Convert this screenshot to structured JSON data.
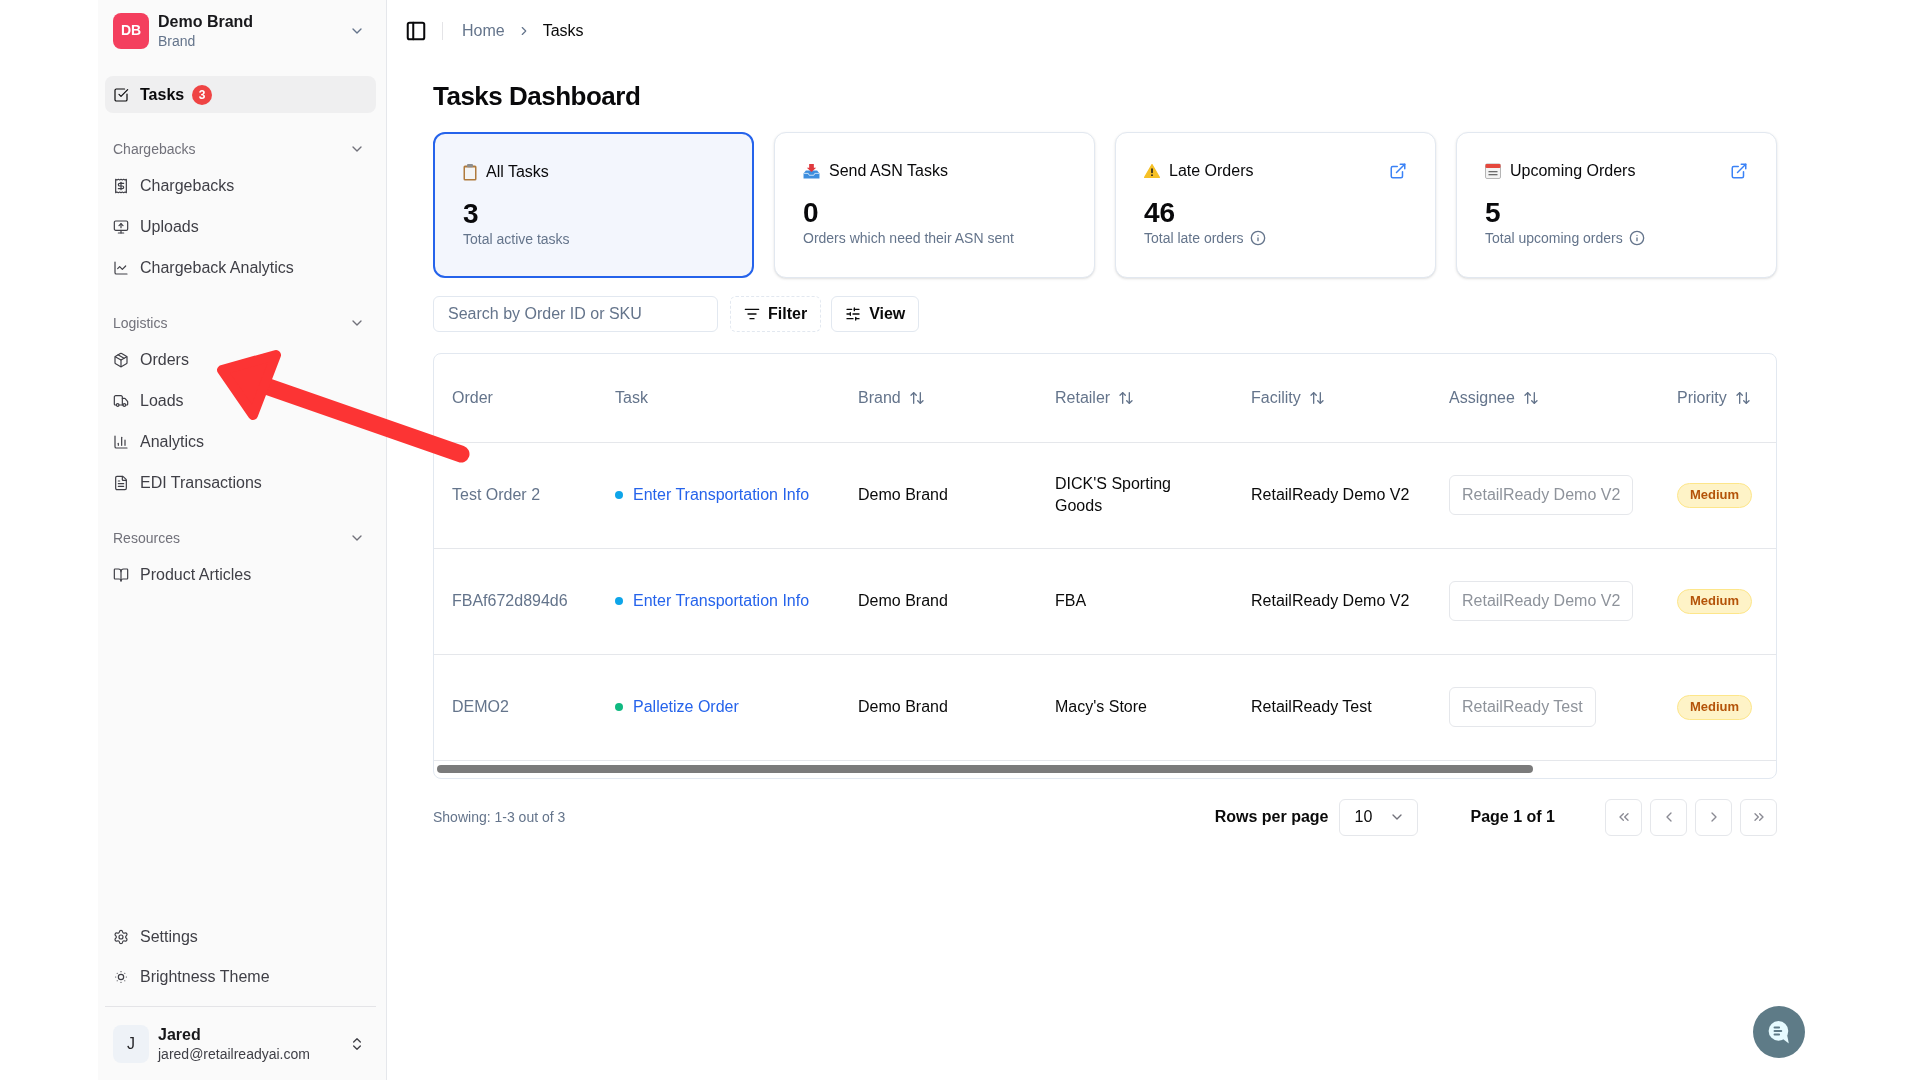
{
  "sidebar": {
    "workspace": {
      "initials": "DB",
      "name": "Demo Brand",
      "subtitle": "Brand"
    },
    "main_item": {
      "label": "Tasks",
      "badge": "3",
      "selected": true
    },
    "sections": [
      {
        "title": "Chargebacks",
        "expanded": true,
        "items": [
          {
            "label": "Chargebacks",
            "selected": false
          },
          {
            "label": "Uploads",
            "selected": false
          },
          {
            "label": "Chargeback Analytics",
            "selected": false
          }
        ]
      },
      {
        "title": "Logistics",
        "expanded": true,
        "items": [
          {
            "label": "Orders",
            "selected": false
          },
          {
            "label": "Loads",
            "selected": false
          },
          {
            "label": "Analytics",
            "selected": false
          },
          {
            "label": "EDI Transactions",
            "selected": false
          }
        ]
      },
      {
        "title": "Resources",
        "expanded": true,
        "items": [
          {
            "label": "Product Articles",
            "selected": false
          }
        ]
      }
    ],
    "footer_items": [
      {
        "label": "Settings",
        "selected": false
      },
      {
        "label": "Brightness Theme",
        "selected": false
      }
    ],
    "user": {
      "initial": "J",
      "name": "Jared",
      "email": "jared@retailreadyai.com"
    }
  },
  "breadcrumb": [
    {
      "label": "Home",
      "current": false
    },
    {
      "label": "Tasks",
      "current": true
    }
  ],
  "title": "Tasks Dashboard",
  "cards": [
    {
      "title": "All Tasks",
      "value": "3",
      "caption": "Total active tasks",
      "selected": true,
      "info": false,
      "external_link": false
    },
    {
      "title": "Send ASN Tasks",
      "value": "0",
      "caption": "Orders which need their ASN sent",
      "selected": false,
      "info": false,
      "external_link": false
    },
    {
      "title": "Late Orders",
      "value": "46",
      "caption": "Total late orders",
      "selected": false,
      "info": true,
      "external_link": true
    },
    {
      "title": "Upcoming Orders",
      "value": "5",
      "caption": "Total upcoming orders",
      "selected": false,
      "info": true,
      "external_link": true
    }
  ],
  "search": {
    "placeholder": "Search by Order ID or SKU"
  },
  "toolbar_buttons": [
    {
      "label": "Filter",
      "kind": "filter"
    },
    {
      "label": "View",
      "kind": "view"
    }
  ],
  "table": {
    "columns": [
      {
        "label": "Order",
        "sortable": false
      },
      {
        "label": "Task",
        "sortable": false
      },
      {
        "label": "Brand",
        "sortable": true
      },
      {
        "label": "Retailer",
        "sortable": true
      },
      {
        "label": "Facility",
        "sortable": true
      },
      {
        "label": "Assignee",
        "sortable": true
      },
      {
        "label": "Priority",
        "sortable": true
      }
    ],
    "rows": [
      {
        "order": "Test Order 2",
        "task": {
          "label": "Enter Transportation Info",
          "color": "#0ea5e9"
        },
        "brand": "Demo Brand",
        "retailer": "DICK'S Sporting Goods",
        "facility": "RetailReady Demo V2",
        "assignee": "RetailReady Demo V2",
        "priority": "Medium"
      },
      {
        "order": "FBAf672d894d6",
        "task": {
          "label": "Enter Transportation Info",
          "color": "#0ea5e9"
        },
        "brand": "Demo Brand",
        "retailer": "FBA",
        "facility": "RetailReady Demo V2",
        "assignee": "RetailReady Demo V2",
        "priority": "Medium"
      },
      {
        "order": "DEMO2",
        "task": {
          "label": "Palletize Order",
          "color": "#10b981"
        },
        "brand": "Demo Brand",
        "retailer": "Macy's Store",
        "facility": "RetailReady Test",
        "assignee": "RetailReady Test",
        "priority": "Medium"
      }
    ]
  },
  "pagination": {
    "summary": "Showing: 1-3 out of 3",
    "rows_per_page_label": "Rows per page",
    "rows_per_page": "10",
    "page_label": "Page 1 of 1",
    "buttons": [
      {
        "kind": "first",
        "disabled": true
      },
      {
        "kind": "previous",
        "disabled": true
      },
      {
        "kind": "next",
        "disabled": true
      },
      {
        "kind": "last",
        "disabled": true
      }
    ]
  }
}
